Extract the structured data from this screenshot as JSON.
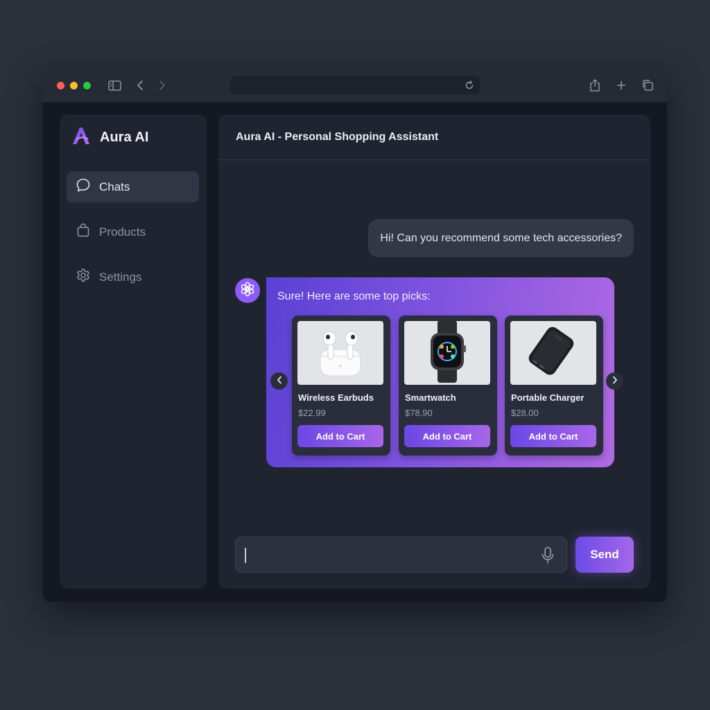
{
  "browser": {
    "url": ""
  },
  "sidebar": {
    "brand": "Aura AI",
    "items": [
      {
        "label": "Chats",
        "icon": "chat-bubble-icon",
        "active": true
      },
      {
        "label": "Products",
        "icon": "shopping-bag-icon",
        "active": false
      },
      {
        "label": "Settings",
        "icon": "gear-icon",
        "active": false
      }
    ]
  },
  "main": {
    "title": "Aura AI - Personal Shopping Assistant"
  },
  "chat": {
    "user_message": "Hi! Can you recommend some tech accessories?",
    "bot_message": "Sure! Here are some top picks:",
    "products": [
      {
        "name": "Wireless Earbuds",
        "price": "$22.99",
        "button": "Add to Cart",
        "icon": "earbuds-icon"
      },
      {
        "name": "Smartwatch",
        "price": "$78.90",
        "button": "Add to Cart",
        "icon": "smartwatch-icon"
      },
      {
        "name": "Portable Charger",
        "price": "$28.00",
        "button": "Add to Cart",
        "icon": "power-bank-icon"
      }
    ]
  },
  "composer": {
    "value": "",
    "placeholder": "",
    "send_label": "Send"
  },
  "colors": {
    "accent": "#8b5cf6",
    "gradient_start": "#5a41d4",
    "gradient_end": "#b06ae2",
    "window_bg": "#141821",
    "panel_bg": "#1f2430"
  }
}
